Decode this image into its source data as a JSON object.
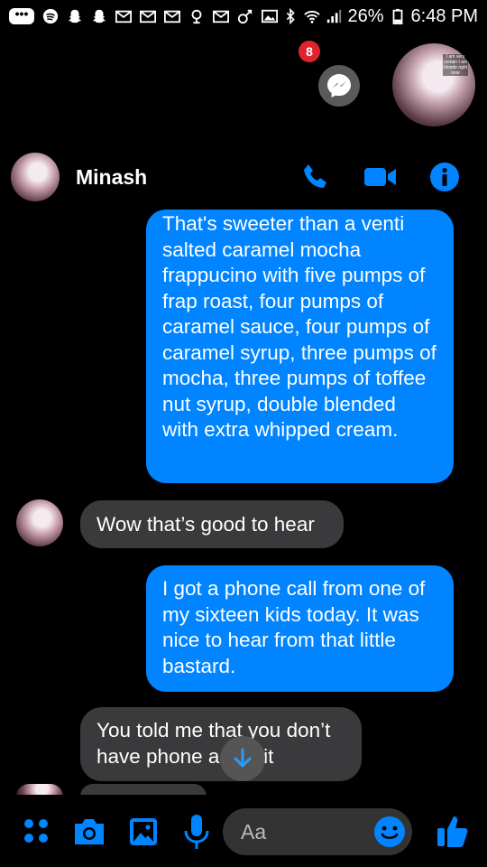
{
  "status_bar": {
    "battery": "26%",
    "time": "6:48 PM",
    "left_icons": [
      "more-notifications-icon",
      "spotify-icon",
      "snapchat-icon",
      "snapchat-icon",
      "gmail-icon",
      "mail-icon",
      "mail-icon",
      "location-icon",
      "mail-icon",
      "link-icon",
      "image-icon"
    ],
    "right_icons": [
      "bluetooth-icon",
      "wifi-icon",
      "signal-icon",
      "battery-icon"
    ]
  },
  "chat_heads": {
    "badge_count": "8",
    "caption": "I am very certain I am blonde right now"
  },
  "header": {
    "contact_name": "Minash"
  },
  "messages": [
    {
      "direction": "out",
      "text": "That's sweeter than a venti salted caramel mocha frappucino with five pumps of frap roast, four pumps of caramel sauce, four pumps of caramel syrup, three pumps of mocha, three pumps of toffee nut syrup, double blended with extra whipped cream."
    },
    {
      "direction": "in",
      "text": "Wow that’s good to hear"
    },
    {
      "direction": "out",
      "text": "I got a phone call from one of my sixteen kids today. It was nice to hear from that little bastard."
    },
    {
      "direction": "in",
      "text": "You told me that you don’t have phone a ave it"
    }
  ],
  "composer": {
    "placeholder": "Aa"
  },
  "colors": {
    "accent": "#0084ff",
    "incoming_bubble": "#3a3a3c",
    "badge": "#e0242f",
    "background": "#000000"
  }
}
